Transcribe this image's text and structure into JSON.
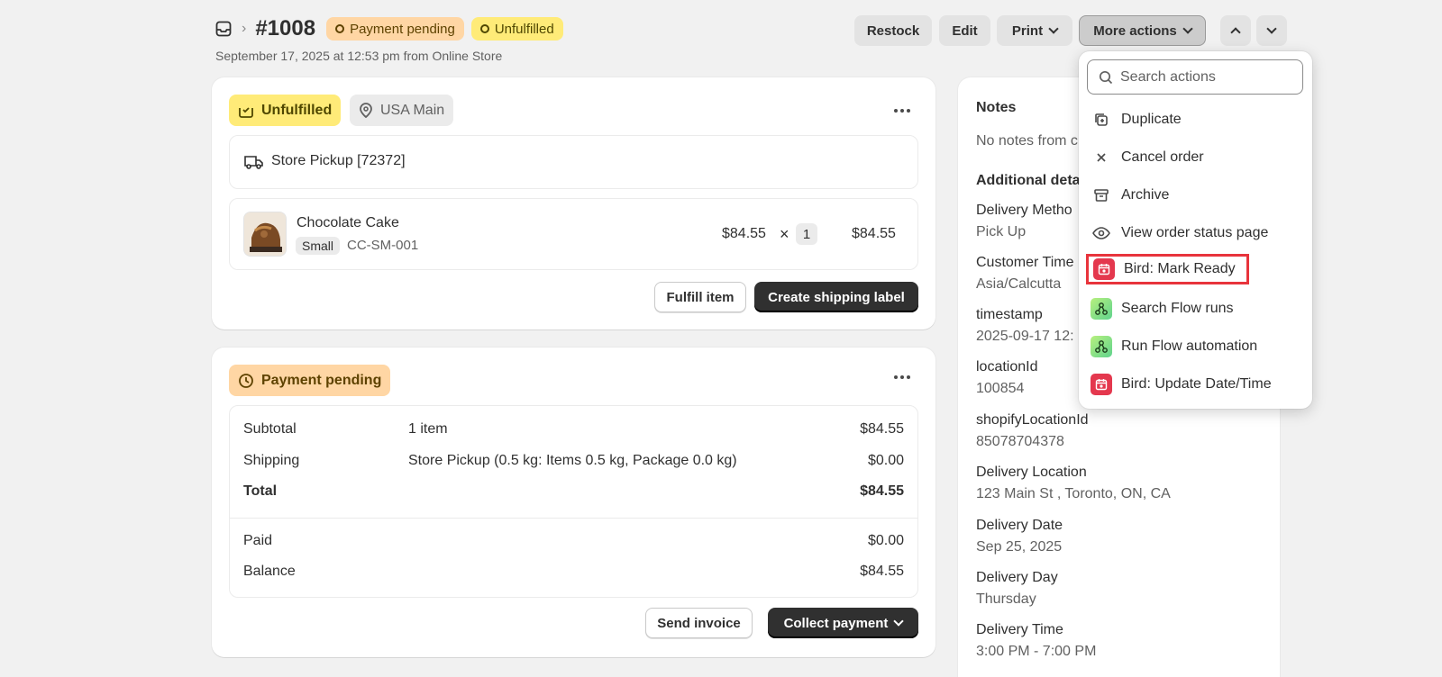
{
  "header": {
    "order_number": "#1008",
    "badges": [
      {
        "label": "Payment pending",
        "color": "#ffd6a4"
      },
      {
        "label": "Unfulfilled",
        "color": "#ffeb78"
      }
    ],
    "subtitle": "September 17, 2025 at 12:53 pm from Online Store",
    "actions": {
      "restock": "Restock",
      "edit": "Edit",
      "print": "Print",
      "more_actions": "More actions"
    }
  },
  "fulfillment_card": {
    "status": "Unfulfilled",
    "location": "USA Main",
    "delivery_method": "Store Pickup [72372]",
    "item": {
      "name": "Chocolate Cake",
      "variant": "Small",
      "sku": "CC-SM-001",
      "unit_price": "$84.55",
      "times": "×",
      "quantity": "1",
      "total": "$84.55"
    },
    "buttons": {
      "fulfill": "Fulfill item",
      "shipping_label": "Create shipping label"
    }
  },
  "payment_card": {
    "status": "Payment pending",
    "rows": [
      {
        "label": "Subtotal",
        "detail": "1 item",
        "amount": "$84.55"
      },
      {
        "label": "Shipping",
        "detail": "Store Pickup (0.5 kg: Items 0.5 kg, Package 0.0 kg)",
        "amount": "$0.00"
      },
      {
        "label": "Total",
        "detail": "",
        "amount": "$84.55"
      }
    ],
    "paid": {
      "label": "Paid",
      "amount": "$0.00"
    },
    "balance": {
      "label": "Balance",
      "amount": "$84.55"
    },
    "buttons": {
      "send_invoice": "Send invoice",
      "collect_payment": "Collect payment"
    }
  },
  "notes_card": {
    "title": "Notes",
    "notes_text": "No notes from c",
    "additional_title": "Additional deta",
    "fields": [
      {
        "label": "Delivery Metho",
        "value": "Pick Up"
      },
      {
        "label": "Customer Time",
        "value": "Asia/Calcutta"
      },
      {
        "label": "timestamp",
        "value": "2025-09-17 12:"
      },
      {
        "label": "locationId",
        "value": "100854"
      },
      {
        "label": "shopifyLocationId",
        "value": "85078704378"
      },
      {
        "label": "Delivery Location",
        "value": "123 Main St , Toronto, ON, CA"
      },
      {
        "label": "Delivery Date",
        "value": "Sep 25, 2025"
      },
      {
        "label": "Delivery Day",
        "value": "Thursday"
      },
      {
        "label": "Delivery Time",
        "value": "3:00 PM - 7:00 PM"
      }
    ]
  },
  "menu": {
    "search_placeholder": "Search actions",
    "items": [
      {
        "label": "Duplicate",
        "icon": "duplicate-icon"
      },
      {
        "label": "Cancel order",
        "icon": "close-icon"
      },
      {
        "label": "Archive",
        "icon": "archive-icon"
      },
      {
        "label": "View order status page",
        "icon": "eye-icon"
      },
      {
        "label": "Bird: Mark Ready",
        "icon": "bird-app-icon"
      },
      {
        "label": "Search Flow runs",
        "icon": "flow-app-icon"
      },
      {
        "label": "Run Flow automation",
        "icon": "flow-app-icon"
      },
      {
        "label": "Bird: Update Date/Time",
        "icon": "bird-app-icon"
      }
    ],
    "highlight_color": "#e8343c"
  }
}
